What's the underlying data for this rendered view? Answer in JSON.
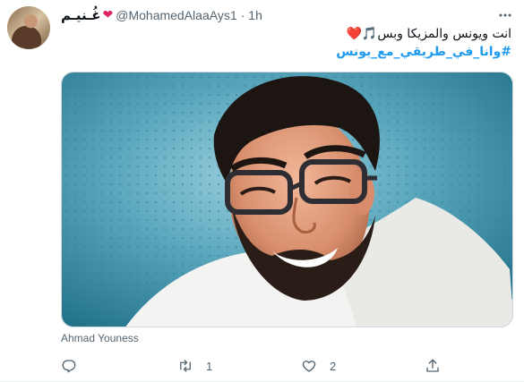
{
  "tweet": {
    "display_name": "غُـنيـم",
    "handle": "@MohamedAlaaAys1",
    "separator": "·",
    "timestamp": "1h",
    "text_line1": "انت ويونس والمزيكا وبس🎵❤️",
    "hashtag": "#وانا_في_طريقي_مع_يونس",
    "image_caption": "Ahmad Youness",
    "reply_count": "",
    "retweet_count": "1",
    "like_count": "2"
  },
  "icons": {
    "more": "more-horizontal-icon",
    "reply": "reply-icon",
    "retweet": "retweet-icon",
    "like": "heart-icon",
    "share": "share-icon"
  },
  "colors": {
    "text": "#0f1419",
    "secondary": "#536471",
    "link": "#1d9bf0",
    "heart": "#e0245e",
    "border": "#cfd9de"
  }
}
